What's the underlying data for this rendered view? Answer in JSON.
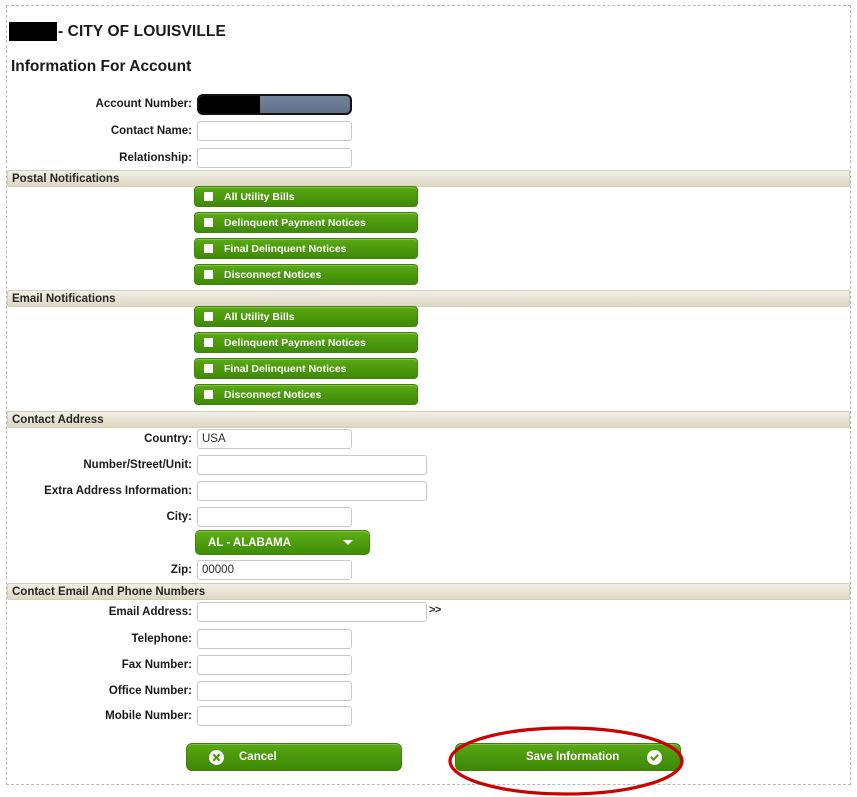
{
  "header": {
    "org_redacted": "",
    "org_name": "- CITY OF LOUISVILLE",
    "page_title": "Information For Account"
  },
  "account_fields": [
    {
      "label": "Account Number:",
      "value": "",
      "type": "readonly-redacted"
    },
    {
      "label": "Contact Name:",
      "value": "",
      "placeholder": ""
    },
    {
      "label": "Relationship:",
      "value": "",
      "placeholder": ""
    }
  ],
  "sections": {
    "postal": {
      "title": "Postal Notifications",
      "options": [
        {
          "label": "All Utility Bills",
          "checked": false
        },
        {
          "label": "Delinquent Payment Notices",
          "checked": false
        },
        {
          "label": "Final Delinquent Notices",
          "checked": false
        },
        {
          "label": "Disconnect Notices",
          "checked": false
        }
      ]
    },
    "email": {
      "title": "Email Notifications",
      "options": [
        {
          "label": "All Utility Bills",
          "checked": false
        },
        {
          "label": "Delinquent Payment Notices",
          "checked": false
        },
        {
          "label": "Final Delinquent Notices",
          "checked": false
        },
        {
          "label": "Disconnect Notices",
          "checked": false
        }
      ]
    },
    "address": {
      "title": "Contact Address",
      "fields": [
        {
          "label": "Country:",
          "value": "USA"
        },
        {
          "label": "Number/Street/Unit:",
          "value": ""
        },
        {
          "label": "Extra Address Information:",
          "value": ""
        },
        {
          "label": "City:",
          "value": ""
        }
      ],
      "state_dropdown": {
        "selected": "AL - ALABAMA",
        "caret": "chevron-down-icon"
      },
      "zip": {
        "label": "Zip:",
        "value": "00000"
      }
    },
    "contact": {
      "title": "Contact Email And Phone Numbers",
      "fields": [
        {
          "label": "Email Address:",
          "value": ""
        },
        {
          "label": "Telephone:",
          "value": ""
        },
        {
          "label": "Fax Number:",
          "value": ""
        },
        {
          "label": "Office Number:",
          "value": ""
        },
        {
          "label": "Mobile Number:",
          "value": ""
        }
      ],
      "email_expand": ">>"
    }
  },
  "actions": {
    "cancel_label": "Cancel",
    "save_label": "Save Information"
  },
  "colors": {
    "green_button": "#4b980d",
    "section_bar": "#e7e2d3",
    "annotation_red": "#cc0000",
    "readonly_field": "#6b7a91"
  }
}
